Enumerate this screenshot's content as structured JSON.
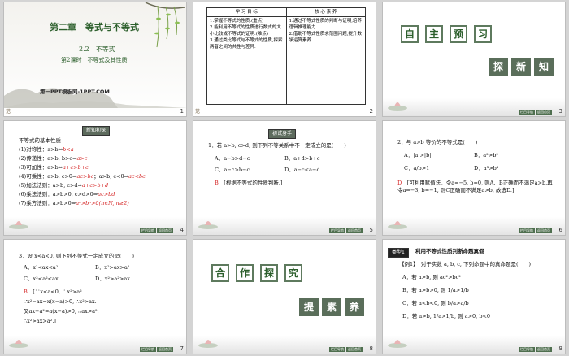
{
  "slide1": {
    "chapter": "第二章　等式与不等式",
    "section": "2.2　不等式",
    "lesson": "第2课时　不等式及其性质",
    "brand": "第一PPT模板网-1PPT.COM",
    "num": "1"
  },
  "slide2": {
    "col1": "学 习 目 标",
    "col2": "核 心 素 养",
    "goals": [
      "1.掌握不等式的性质.(重点)",
      "2.能利用不等式的性质进行数式的大小比较或不等式的证明.(难点)",
      "3.通过类比等式与不等式的性质,探索两者之间的共性与差异."
    ],
    "cores": [
      "1.通过不等式性质的判断与证明,培养逻辑推理能力.",
      "2.借助不等式性质求范围问题,提升数学运算素养."
    ],
    "num": "2"
  },
  "slide3": {
    "row1": [
      "自",
      "主",
      "预",
      "习"
    ],
    "row2": [
      "探",
      "新",
      "知"
    ],
    "num": "3"
  },
  "slide4": {
    "badge": "新知初探",
    "heading": "不等式的基本性质",
    "lines": [
      {
        "lead": "(1)对称性：a>b⇔",
        "ans": "b<a"
      },
      {
        "lead": "(2)传递性：a>b, b>c⇒",
        "ans": "a>c"
      },
      {
        "lead": "(3)可加性：a>b⇔",
        "ans": "a+c>b+c"
      },
      {
        "lead": "(4)可乘性：a>b, c>0⇒",
        "ans": "ac>bc",
        "mid": "；a>b, c<0⇒",
        "ans2": "ac<bc"
      },
      {
        "lead": "(5)加法法则：a>b, c>d⇒",
        "ans": "a+c>b+d"
      },
      {
        "lead": "(6)乘法法则：a>b>0, c>d>0⇒",
        "ans": "ac>bd"
      },
      {
        "lead": "(7)乘方法则：a>b>0⇒",
        "ans": "aⁿ>bⁿ>0(n∈N, n≥2)"
      }
    ],
    "num": "4"
  },
  "slide5": {
    "badge": "初试身手",
    "question": "1．若 a>b, c>d, 则下列不等关系中不一定成立的是(　　)",
    "options": [
      "A．a−b>d−c",
      "B．a+d>b+c",
      "C．a−c>b−c",
      "D．a−c<a−d"
    ],
    "answer": "B",
    "explain": "[根据不等式的性质判断.]",
    "num": "5"
  },
  "slide6": {
    "question": "2．与 a>b 等价的不等式是(　　)",
    "options": [
      "A．|a|>|b|",
      "B．a²>b²",
      "C．a/b>1",
      "D．a³>b³"
    ],
    "answer": "D",
    "explain": "[可利用赋值法．令a=−5, b=0, 则A、B正确而不满足a>b.再令a=−3, b=−1, 则C正确而不满足a>b, 故选D.]",
    "num": "6"
  },
  "slide7": {
    "question": "3．设 x<a<0, 则下列不等式一定成立的是(　　)",
    "options": [
      "A．x²<ax<a²",
      "B．x²>ax>a²",
      "C．x²<a²<ax",
      "D．x²>a²>ax"
    ],
    "answer": "B",
    "explain": [
      "[∵x<a<0, ∴x²>a².",
      "∵x²−ax=x(x−a)>0, ∴x²>ax.",
      "又ax−a²=a(x−a)>0, ∴ax>a².",
      "∴x²>ax>a².]"
    ],
    "num": "7"
  },
  "slide8": {
    "row1": [
      "合",
      "作",
      "探",
      "究"
    ],
    "row2": [
      "提",
      "素",
      "养"
    ],
    "num": "8"
  },
  "slide9": {
    "badge": "类型1",
    "title": "利用不等式性质判断命题真假",
    "example": "【例1】　对于实数 a, b, c, 下列命题中的真命题是(　　)",
    "options": [
      "A．若 a>b, 则 ac²>bc²",
      "B．若 a>b>0, 则 1/a>1/b",
      "C．若 a<b<0, 则 b/a>a/b",
      "D．若 a>b, 1/a>1/b, 则 a>0, b<0"
    ],
    "num": "9"
  },
  "footer": {
    "corner": "范",
    "nav": [
      "栏目导航",
      "返回首页"
    ]
  },
  "colors": {
    "accent_red": "#d42020",
    "title_green": "#2c5f2c",
    "badge_bg": "#5d6b5d"
  }
}
